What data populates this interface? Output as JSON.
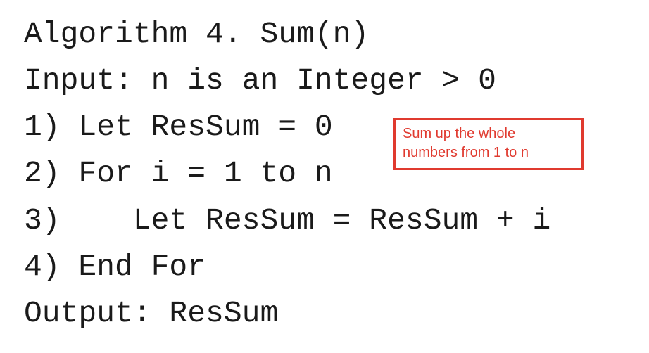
{
  "algorithm": {
    "title": "Algorithm 4. Sum(n)",
    "input": "Input: n is an Integer > 0",
    "steps": [
      "1) Let ResSum = 0",
      "2) For i = 1 to n",
      "3)    Let ResSum = ResSum + i",
      "4) End For"
    ],
    "output": "Output: ResSum"
  },
  "annotation": {
    "text": "Sum up the whole\nnumbers from 1 to n",
    "color": "#e03a2f"
  }
}
